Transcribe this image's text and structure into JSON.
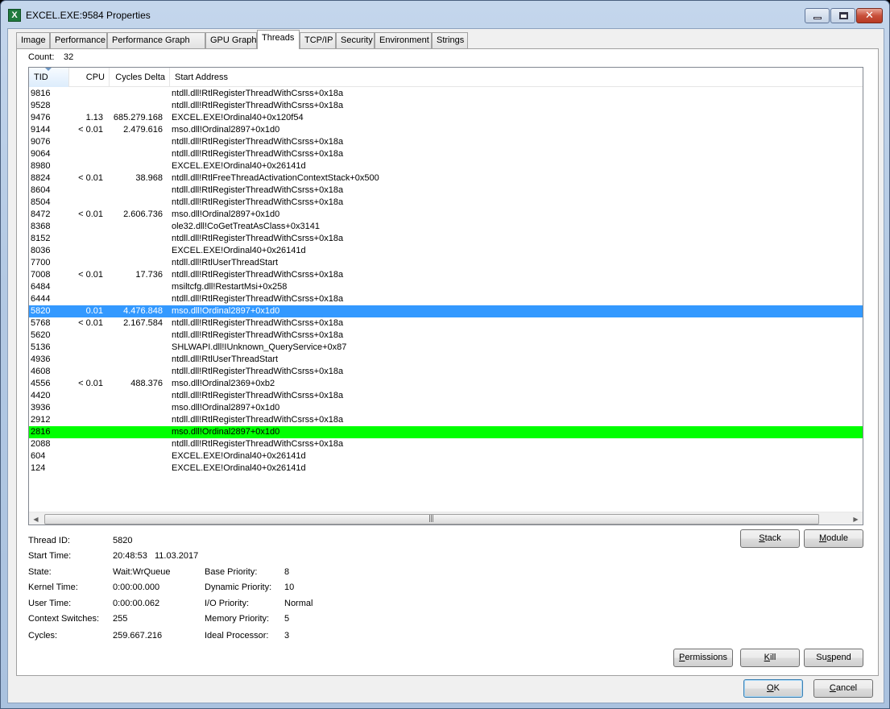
{
  "window": {
    "title": "EXCEL.EXE:9584 Properties",
    "app_icon_letter": "X",
    "controls": {
      "minimize": "minimize",
      "maximize": "maximize",
      "close": "✕"
    }
  },
  "tabs": [
    "Image",
    "Performance",
    "Performance Graph",
    "GPU Graph",
    "Threads",
    "TCP/IP",
    "Security",
    "Environment",
    "Strings"
  ],
  "active_tab": "Threads",
  "count_label": "Count:",
  "count_value": "32",
  "columns": {
    "tid": "TID",
    "cpu": "CPU",
    "cycles": "Cycles Delta",
    "address": "Start Address"
  },
  "threads": [
    {
      "tid": "9816",
      "cpu": "",
      "cycles": "",
      "addr": "ntdll.dll!RtlRegisterThreadWithCsrss+0x18a"
    },
    {
      "tid": "9528",
      "cpu": "",
      "cycles": "",
      "addr": "ntdll.dll!RtlRegisterThreadWithCsrss+0x18a"
    },
    {
      "tid": "9476",
      "cpu": "1.13",
      "cycles": "685.279.168",
      "addr": "EXCEL.EXE!Ordinal40+0x120f54"
    },
    {
      "tid": "9144",
      "cpu": "< 0.01",
      "cycles": "2.479.616",
      "addr": "mso.dll!Ordinal2897+0x1d0"
    },
    {
      "tid": "9076",
      "cpu": "",
      "cycles": "",
      "addr": "ntdll.dll!RtlRegisterThreadWithCsrss+0x18a"
    },
    {
      "tid": "9064",
      "cpu": "",
      "cycles": "",
      "addr": "ntdll.dll!RtlRegisterThreadWithCsrss+0x18a"
    },
    {
      "tid": "8980",
      "cpu": "",
      "cycles": "",
      "addr": "EXCEL.EXE!Ordinal40+0x26141d"
    },
    {
      "tid": "8824",
      "cpu": "< 0.01",
      "cycles": "38.968",
      "addr": "ntdll.dll!RtlFreeThreadActivationContextStack+0x500"
    },
    {
      "tid": "8604",
      "cpu": "",
      "cycles": "",
      "addr": "ntdll.dll!RtlRegisterThreadWithCsrss+0x18a"
    },
    {
      "tid": "8504",
      "cpu": "",
      "cycles": "",
      "addr": "ntdll.dll!RtlRegisterThreadWithCsrss+0x18a"
    },
    {
      "tid": "8472",
      "cpu": "< 0.01",
      "cycles": "2.606.736",
      "addr": "mso.dll!Ordinal2897+0x1d0"
    },
    {
      "tid": "8368",
      "cpu": "",
      "cycles": "",
      "addr": "ole32.dll!CoGetTreatAsClass+0x3141"
    },
    {
      "tid": "8152",
      "cpu": "",
      "cycles": "",
      "addr": "ntdll.dll!RtlRegisterThreadWithCsrss+0x18a"
    },
    {
      "tid": "8036",
      "cpu": "",
      "cycles": "",
      "addr": "EXCEL.EXE!Ordinal40+0x26141d"
    },
    {
      "tid": "7700",
      "cpu": "",
      "cycles": "",
      "addr": "ntdll.dll!RtlUserThreadStart"
    },
    {
      "tid": "7008",
      "cpu": "< 0.01",
      "cycles": "17.736",
      "addr": "ntdll.dll!RtlRegisterThreadWithCsrss+0x18a"
    },
    {
      "tid": "6484",
      "cpu": "",
      "cycles": "",
      "addr": "msiltcfg.dll!RestartMsi+0x258"
    },
    {
      "tid": "6444",
      "cpu": "",
      "cycles": "",
      "addr": "ntdll.dll!RtlRegisterThreadWithCsrss+0x18a"
    },
    {
      "tid": "5820",
      "cpu": "0.01",
      "cycles": "4.476.848",
      "addr": "mso.dll!Ordinal2897+0x1d0",
      "state": "selected"
    },
    {
      "tid": "5768",
      "cpu": "< 0.01",
      "cycles": "2.167.584",
      "addr": "ntdll.dll!RtlRegisterThreadWithCsrss+0x18a"
    },
    {
      "tid": "5620",
      "cpu": "",
      "cycles": "",
      "addr": "ntdll.dll!RtlRegisterThreadWithCsrss+0x18a"
    },
    {
      "tid": "5136",
      "cpu": "",
      "cycles": "",
      "addr": "SHLWAPI.dll!IUnknown_QueryService+0x87"
    },
    {
      "tid": "4936",
      "cpu": "",
      "cycles": "",
      "addr": "ntdll.dll!RtlUserThreadStart"
    },
    {
      "tid": "4608",
      "cpu": "",
      "cycles": "",
      "addr": "ntdll.dll!RtlRegisterThreadWithCsrss+0x18a"
    },
    {
      "tid": "4556",
      "cpu": "< 0.01",
      "cycles": "488.376",
      "addr": "mso.dll!Ordinal2369+0xb2"
    },
    {
      "tid": "4420",
      "cpu": "",
      "cycles": "",
      "addr": "ntdll.dll!RtlRegisterThreadWithCsrss+0x18a"
    },
    {
      "tid": "3936",
      "cpu": "",
      "cycles": "",
      "addr": "mso.dll!Ordinal2897+0x1d0"
    },
    {
      "tid": "2912",
      "cpu": "",
      "cycles": "",
      "addr": "ntdll.dll!RtlRegisterThreadWithCsrss+0x18a"
    },
    {
      "tid": "2816",
      "cpu": "",
      "cycles": "",
      "addr": "mso.dll!Ordinal2897+0x1d0",
      "state": "new"
    },
    {
      "tid": "2088",
      "cpu": "",
      "cycles": "",
      "addr": "ntdll.dll!RtlRegisterThreadWithCsrss+0x18a"
    },
    {
      "tid": "604",
      "cpu": "",
      "cycles": "",
      "addr": "EXCEL.EXE!Ordinal40+0x26141d"
    },
    {
      "tid": "124",
      "cpu": "",
      "cycles": "",
      "addr": "EXCEL.EXE!Ordinal40+0x26141d"
    }
  ],
  "scrollbar": {
    "left_arrow": "◀",
    "right_arrow": "▶",
    "grip": "|||"
  },
  "details": {
    "thread_id_label": "Thread ID:",
    "thread_id": "5820",
    "start_time_label": "Start Time:",
    "start_time": "20:48:53   11.03.2017",
    "state_label": "State:",
    "state": "Wait:WrQueue",
    "kernel_time_label": "Kernel Time:",
    "kernel_time": "0:00:00.000",
    "user_time_label": "User Time:",
    "user_time": "0:00:00.062",
    "context_switches_label": "Context Switches:",
    "context_switches": "255",
    "cycles_label": "Cycles:",
    "cycles": "259.667.216",
    "base_priority_label": "Base Priority:",
    "base_priority": "8",
    "dynamic_priority_label": "Dynamic Priority:",
    "dynamic_priority": "10",
    "io_priority_label": "I/O Priority:",
    "io_priority": "Normal",
    "memory_priority_label": "Memory Priority:",
    "memory_priority": "5",
    "ideal_processor_label": "Ideal Processor:",
    "ideal_processor": "3"
  },
  "buttons": {
    "stack": {
      "pre": "",
      "key": "S",
      "post": "tack"
    },
    "module": {
      "pre": "",
      "key": "M",
      "post": "odule"
    },
    "permissions": {
      "pre": "",
      "key": "P",
      "post": "ermissions"
    },
    "kill": {
      "pre": "",
      "key": "K",
      "post": "ill"
    },
    "suspend": {
      "pre": "Su",
      "key": "s",
      "post": "pend"
    },
    "ok": {
      "pre": "",
      "key": "O",
      "post": "K"
    },
    "cancel": {
      "pre": "",
      "key": "C",
      "post": "ancel"
    }
  },
  "colors": {
    "selected_row": "#3399ff",
    "new_thread_row": "#00ff00"
  }
}
